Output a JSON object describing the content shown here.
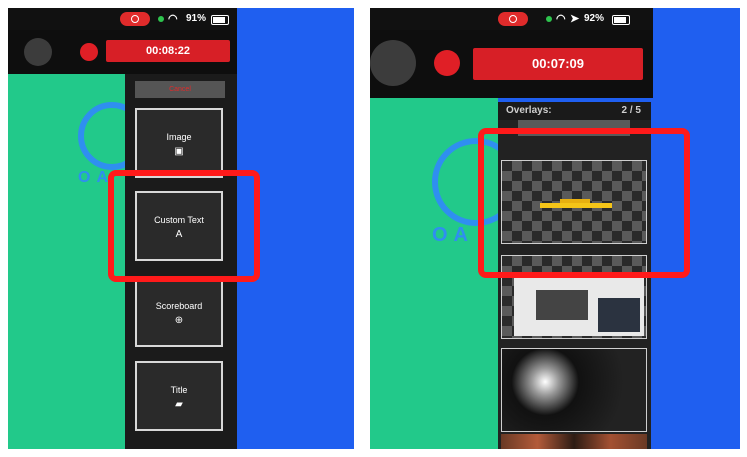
{
  "left": {
    "status": {
      "battery": "91%"
    },
    "timer": "00:08:22",
    "logo_text": "OA",
    "menu": {
      "cancel_label": "Cancel",
      "items": [
        {
          "label": "Image",
          "icon": "image-icon",
          "glyph": "▣"
        },
        {
          "label": "Custom Text",
          "icon": "text-icon",
          "glyph": "A"
        },
        {
          "label": "Scoreboard",
          "icon": "scoreboard-icon",
          "glyph": "⊕"
        },
        {
          "label": "Title",
          "icon": "title-icon",
          "glyph": "▰"
        }
      ]
    }
  },
  "right": {
    "status": {
      "battery": "92%"
    },
    "timer": "00:07:09",
    "logo_text": "OA",
    "overlays": {
      "label": "Overlays:",
      "count": "2 / 5"
    }
  },
  "colors": {
    "background": "#1f5ff0",
    "record_red": "#d71f26",
    "highlight_red": "#ff1a1a",
    "green_screen": "#22c98a",
    "logo_blue": "#2f8ff0"
  }
}
